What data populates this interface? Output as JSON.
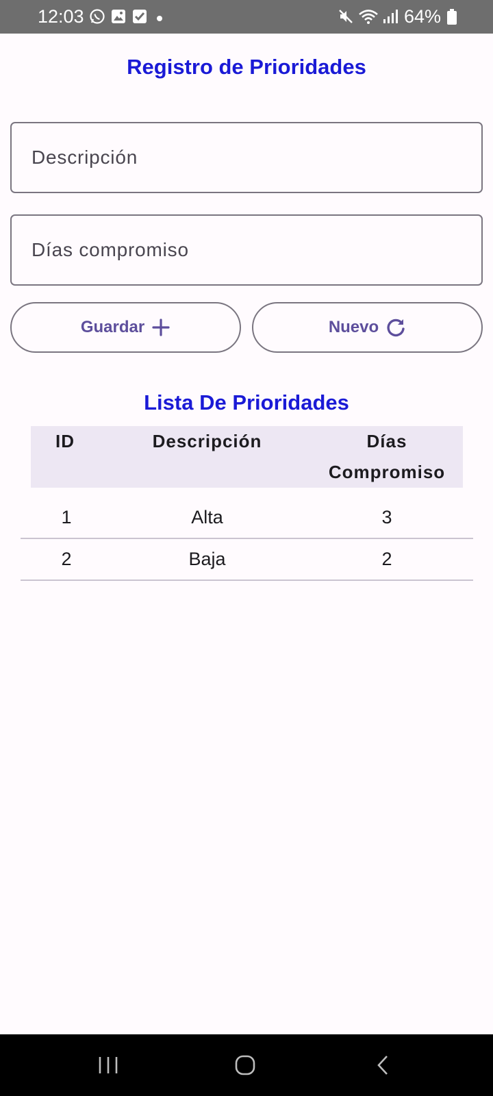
{
  "status_bar": {
    "time": "12:03",
    "battery": "64%"
  },
  "page": {
    "title": "Registro de Prioridades"
  },
  "form": {
    "descripcion_placeholder": "Descripción",
    "dias_placeholder": "Días compromiso"
  },
  "buttons": {
    "guardar_label": "Guardar",
    "nuevo_label": "Nuevo"
  },
  "list": {
    "title": "Lista De Prioridades",
    "columns": {
      "id": "ID",
      "descripcion": "Descripción",
      "dias_line1": "Días",
      "dias_line2": "Compromiso"
    },
    "rows": [
      {
        "id": "1",
        "descripcion": "Alta",
        "dias": "3"
      },
      {
        "id": "2",
        "descripcion": "Baja",
        "dias": "2"
      }
    ]
  },
  "colors": {
    "accent_title": "#1a1ad6",
    "button_text": "#5d4e9c",
    "header_bg": "#ede7f3",
    "background": "#fffbfe"
  }
}
